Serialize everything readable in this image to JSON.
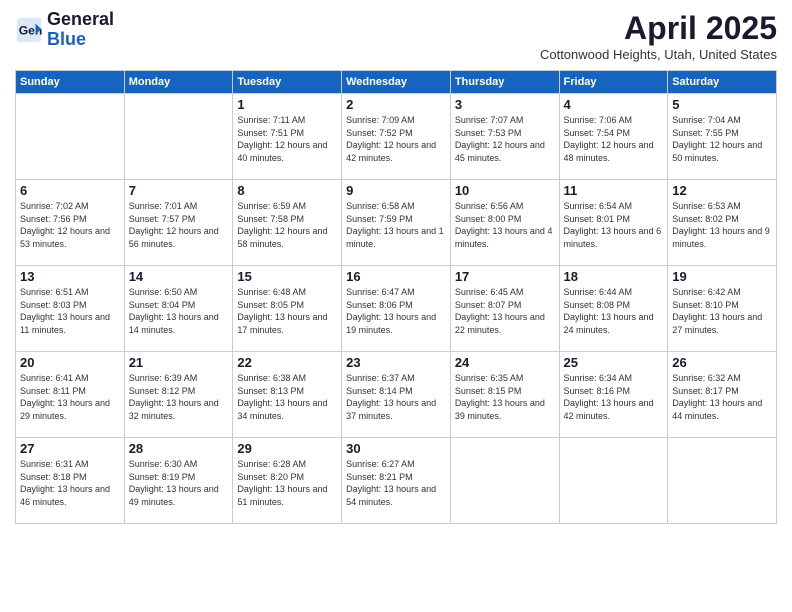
{
  "logo": {
    "line1": "General",
    "line2": "Blue"
  },
  "header": {
    "month": "April 2025",
    "location": "Cottonwood Heights, Utah, United States"
  },
  "weekdays": [
    "Sunday",
    "Monday",
    "Tuesday",
    "Wednesday",
    "Thursday",
    "Friday",
    "Saturday"
  ],
  "weeks": [
    [
      null,
      null,
      {
        "day": 1,
        "sunrise": "7:11 AM",
        "sunset": "7:51 PM",
        "daylight": "12 hours and 40 minutes."
      },
      {
        "day": 2,
        "sunrise": "7:09 AM",
        "sunset": "7:52 PM",
        "daylight": "12 hours and 42 minutes."
      },
      {
        "day": 3,
        "sunrise": "7:07 AM",
        "sunset": "7:53 PM",
        "daylight": "12 hours and 45 minutes."
      },
      {
        "day": 4,
        "sunrise": "7:06 AM",
        "sunset": "7:54 PM",
        "daylight": "12 hours and 48 minutes."
      },
      {
        "day": 5,
        "sunrise": "7:04 AM",
        "sunset": "7:55 PM",
        "daylight": "12 hours and 50 minutes."
      }
    ],
    [
      {
        "day": 6,
        "sunrise": "7:02 AM",
        "sunset": "7:56 PM",
        "daylight": "12 hours and 53 minutes."
      },
      {
        "day": 7,
        "sunrise": "7:01 AM",
        "sunset": "7:57 PM",
        "daylight": "12 hours and 56 minutes."
      },
      {
        "day": 8,
        "sunrise": "6:59 AM",
        "sunset": "7:58 PM",
        "daylight": "12 hours and 58 minutes."
      },
      {
        "day": 9,
        "sunrise": "6:58 AM",
        "sunset": "7:59 PM",
        "daylight": "13 hours and 1 minute."
      },
      {
        "day": 10,
        "sunrise": "6:56 AM",
        "sunset": "8:00 PM",
        "daylight": "13 hours and 4 minutes."
      },
      {
        "day": 11,
        "sunrise": "6:54 AM",
        "sunset": "8:01 PM",
        "daylight": "13 hours and 6 minutes."
      },
      {
        "day": 12,
        "sunrise": "6:53 AM",
        "sunset": "8:02 PM",
        "daylight": "13 hours and 9 minutes."
      }
    ],
    [
      {
        "day": 13,
        "sunrise": "6:51 AM",
        "sunset": "8:03 PM",
        "daylight": "13 hours and 11 minutes."
      },
      {
        "day": 14,
        "sunrise": "6:50 AM",
        "sunset": "8:04 PM",
        "daylight": "13 hours and 14 minutes."
      },
      {
        "day": 15,
        "sunrise": "6:48 AM",
        "sunset": "8:05 PM",
        "daylight": "13 hours and 17 minutes."
      },
      {
        "day": 16,
        "sunrise": "6:47 AM",
        "sunset": "8:06 PM",
        "daylight": "13 hours and 19 minutes."
      },
      {
        "day": 17,
        "sunrise": "6:45 AM",
        "sunset": "8:07 PM",
        "daylight": "13 hours and 22 minutes."
      },
      {
        "day": 18,
        "sunrise": "6:44 AM",
        "sunset": "8:08 PM",
        "daylight": "13 hours and 24 minutes."
      },
      {
        "day": 19,
        "sunrise": "6:42 AM",
        "sunset": "8:10 PM",
        "daylight": "13 hours and 27 minutes."
      }
    ],
    [
      {
        "day": 20,
        "sunrise": "6:41 AM",
        "sunset": "8:11 PM",
        "daylight": "13 hours and 29 minutes."
      },
      {
        "day": 21,
        "sunrise": "6:39 AM",
        "sunset": "8:12 PM",
        "daylight": "13 hours and 32 minutes."
      },
      {
        "day": 22,
        "sunrise": "6:38 AM",
        "sunset": "8:13 PM",
        "daylight": "13 hours and 34 minutes."
      },
      {
        "day": 23,
        "sunrise": "6:37 AM",
        "sunset": "8:14 PM",
        "daylight": "13 hours and 37 minutes."
      },
      {
        "day": 24,
        "sunrise": "6:35 AM",
        "sunset": "8:15 PM",
        "daylight": "13 hours and 39 minutes."
      },
      {
        "day": 25,
        "sunrise": "6:34 AM",
        "sunset": "8:16 PM",
        "daylight": "13 hours and 42 minutes."
      },
      {
        "day": 26,
        "sunrise": "6:32 AM",
        "sunset": "8:17 PM",
        "daylight": "13 hours and 44 minutes."
      }
    ],
    [
      {
        "day": 27,
        "sunrise": "6:31 AM",
        "sunset": "8:18 PM",
        "daylight": "13 hours and 46 minutes."
      },
      {
        "day": 28,
        "sunrise": "6:30 AM",
        "sunset": "8:19 PM",
        "daylight": "13 hours and 49 minutes."
      },
      {
        "day": 29,
        "sunrise": "6:28 AM",
        "sunset": "8:20 PM",
        "daylight": "13 hours and 51 minutes."
      },
      {
        "day": 30,
        "sunrise": "6:27 AM",
        "sunset": "8:21 PM",
        "daylight": "13 hours and 54 minutes."
      },
      null,
      null,
      null
    ]
  ]
}
